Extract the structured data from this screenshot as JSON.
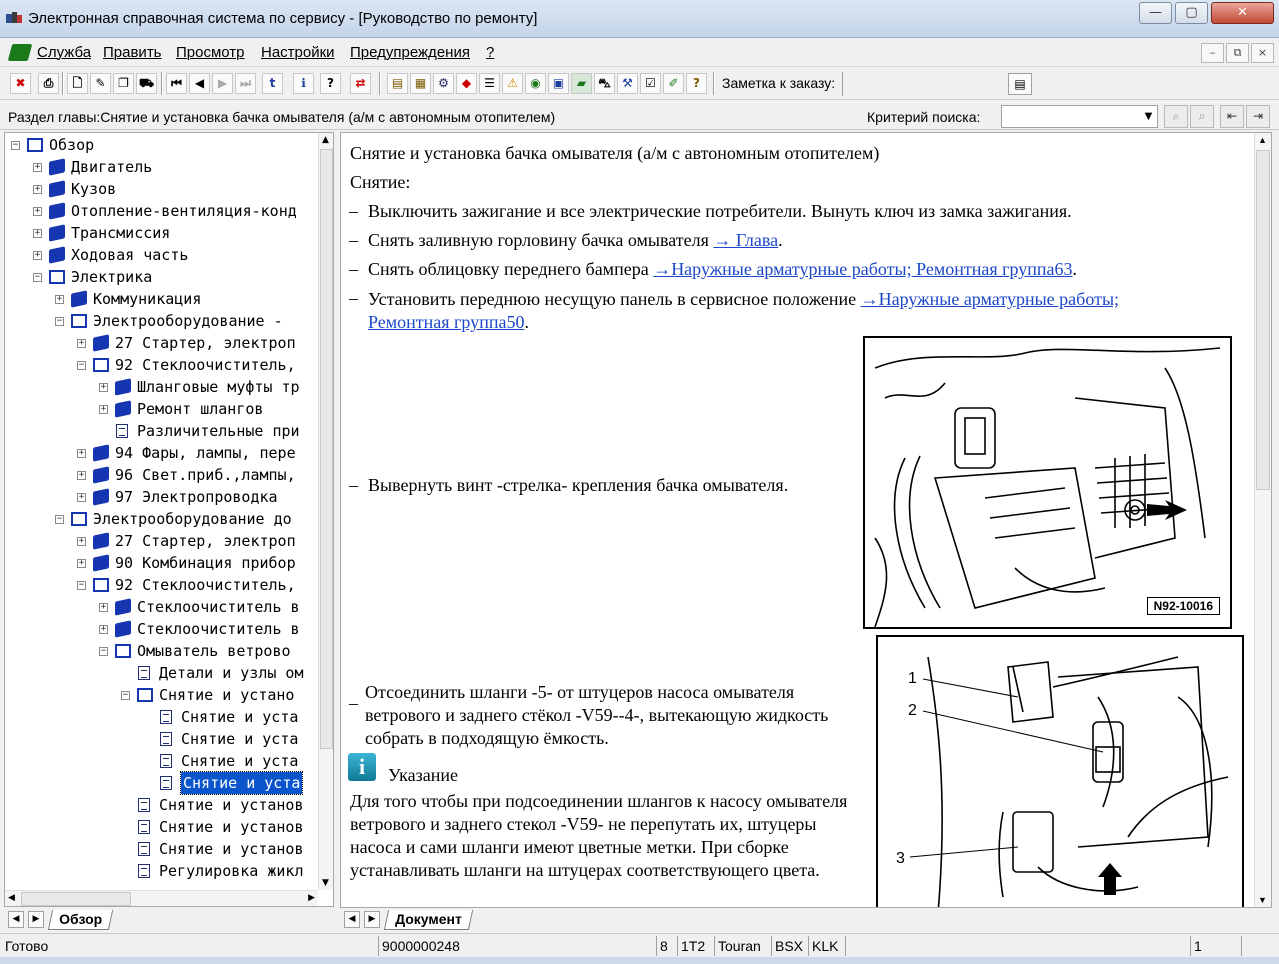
{
  "window": {
    "title": "Электронная справочная система по сервису - [Руководство по ремонту]",
    "min": "—",
    "max": "▢",
    "close": "✕"
  },
  "menu": {
    "items": [
      "Служба",
      "Править",
      "Просмотр",
      "Настройки",
      "Предупреждения",
      "?"
    ],
    "mdi": [
      "–",
      "⧉",
      "×"
    ]
  },
  "toolbar": {
    "note_label": "Заметка к заказу:",
    "note_value": ""
  },
  "section": {
    "title": "Раздел главы:Снятие и установка бачка омывателя (а/м с автономным отопителем)",
    "search_label": "Критерий  поиска:",
    "search_value": ""
  },
  "tree": {
    "nodes": [
      {
        "label": "Обзор",
        "icon": "open-book-icon",
        "expander": "−"
      },
      {
        "label": "Двигатель",
        "icon": "book-icon",
        "expander": "+"
      },
      {
        "label": "Кузов",
        "icon": "book-icon",
        "expander": "+"
      },
      {
        "label": "Отопление-вентиляция-конд",
        "icon": "book-icon",
        "expander": "+"
      },
      {
        "label": "Трансмиссия",
        "icon": "book-icon",
        "expander": "+"
      },
      {
        "label": "Ходовая часть",
        "icon": "book-icon",
        "expander": "+"
      },
      {
        "label": "Электрика",
        "icon": "open-book-icon",
        "expander": "−"
      },
      {
        "label": "Коммуникация",
        "icon": "book-icon",
        "expander": "+"
      },
      {
        "label": "Электрооборудование -",
        "icon": "open-book-icon",
        "expander": "−"
      },
      {
        "label": "27 Стартер, электроп",
        "icon": "book-icon",
        "expander": "+"
      },
      {
        "label": "92 Стеклоочиститель,",
        "icon": "open-book-icon",
        "expander": "−"
      },
      {
        "label": "Шланговые муфты тр",
        "icon": "book-icon",
        "expander": "+"
      },
      {
        "label": "Ремонт шлангов",
        "icon": "book-icon",
        "expander": "+"
      },
      {
        "label": "Различительные при",
        "icon": "document-icon",
        "expander": ""
      },
      {
        "label": "94 Фары, лампы, пере",
        "icon": "book-icon",
        "expander": "+"
      },
      {
        "label": "96 Свет.приб.,лампы,",
        "icon": "book-icon",
        "expander": "+"
      },
      {
        "label": "97 Электропроводка",
        "icon": "book-icon",
        "expander": "+"
      },
      {
        "label": "Электрооборудование до",
        "icon": "open-book-icon",
        "expander": "−"
      },
      {
        "label": "27 Стартер, электроп",
        "icon": "book-icon",
        "expander": "+"
      },
      {
        "label": "90 Комбинация прибор",
        "icon": "book-icon",
        "expander": "+"
      },
      {
        "label": "92 Стеклоочиститель,",
        "icon": "open-book-icon",
        "expander": "−"
      },
      {
        "label": "Стеклоочиститель в",
        "icon": "book-icon",
        "expander": "+"
      },
      {
        "label": "Стеклоочиститель в",
        "icon": "book-icon",
        "expander": "+"
      },
      {
        "label": "Омыватель ветрово",
        "icon": "open-book-icon",
        "expander": "−"
      },
      {
        "label": "Детали и узлы ом",
        "icon": "document-icon",
        "expander": ""
      },
      {
        "label": "Снятие и устано",
        "icon": "open-book-icon",
        "expander": "−"
      },
      {
        "label": "Снятие и уста",
        "icon": "document-icon",
        "expander": ""
      },
      {
        "label": "Снятие и уста",
        "icon": "document-icon",
        "expander": ""
      },
      {
        "label": "Снятие и уста",
        "icon": "document-icon",
        "expander": ""
      },
      {
        "label": "Снятие и уста",
        "icon": "document-icon",
        "expander": "",
        "selected": true
      },
      {
        "label": "Снятие и установ",
        "icon": "document-icon",
        "expander": ""
      },
      {
        "label": "Снятие и установ",
        "icon": "document-icon",
        "expander": ""
      },
      {
        "label": "Снятие и установ",
        "icon": "document-icon",
        "expander": ""
      },
      {
        "label": "Регулировка жикл",
        "icon": "document-icon",
        "expander": ""
      }
    ]
  },
  "tabs": {
    "left": "Обзор",
    "right": "Документ"
  },
  "document": {
    "heading": "Снятие и установка бачка омывателя (а/м с автономным отопителем)",
    "subheading": "Снятие:",
    "dash": "–",
    "steps": [
      {
        "text": "Выключить зажигание и все электрические потребители. Вынуть ключ из замка зажигания."
      },
      {
        "text": "Снять заливную горловину бачка омывателя ",
        "link": "→ Глава",
        "after": "."
      },
      {
        "text": "Снять облицовку переднего бампера ",
        "link": "→Наружные арматурные работы; Ремонтная группа63",
        "after": "."
      },
      {
        "text": "Установить переднюю несущую панель в сервисное положение ",
        "link": "→Наружные арматурные работы; Ремонтная группа50",
        "after": "."
      },
      {
        "text": "Вывернуть винт -стрелка- крепления бачка омывателя."
      },
      {
        "text": "Отсоединить шланги -5- от штуцеров насоса омывателя ветрового и заднего стёкол -V59--4-, вытекающую жидкость собрать в подходящую ёмкость."
      }
    ],
    "note_icon": "i",
    "note_title": "Указание",
    "note_text": "Для того чтобы при подсоединении шлангов к насосу омывателя ветрового и заднего стекол -V59- не перепутать их, штуцеры насоса и сами шланги имеют цветные метки. При сборке устанавливать шланги на штуцерах соответствующего цвета.",
    "figure1_label": "N92-10016",
    "figure2_callouts": [
      "1",
      "2",
      "3"
    ]
  },
  "status": {
    "state": "Готово",
    "doc_number": "9000000248",
    "cells": [
      "8",
      "1T2",
      "Touran",
      "BSX",
      "KLK"
    ],
    "page": "1"
  }
}
